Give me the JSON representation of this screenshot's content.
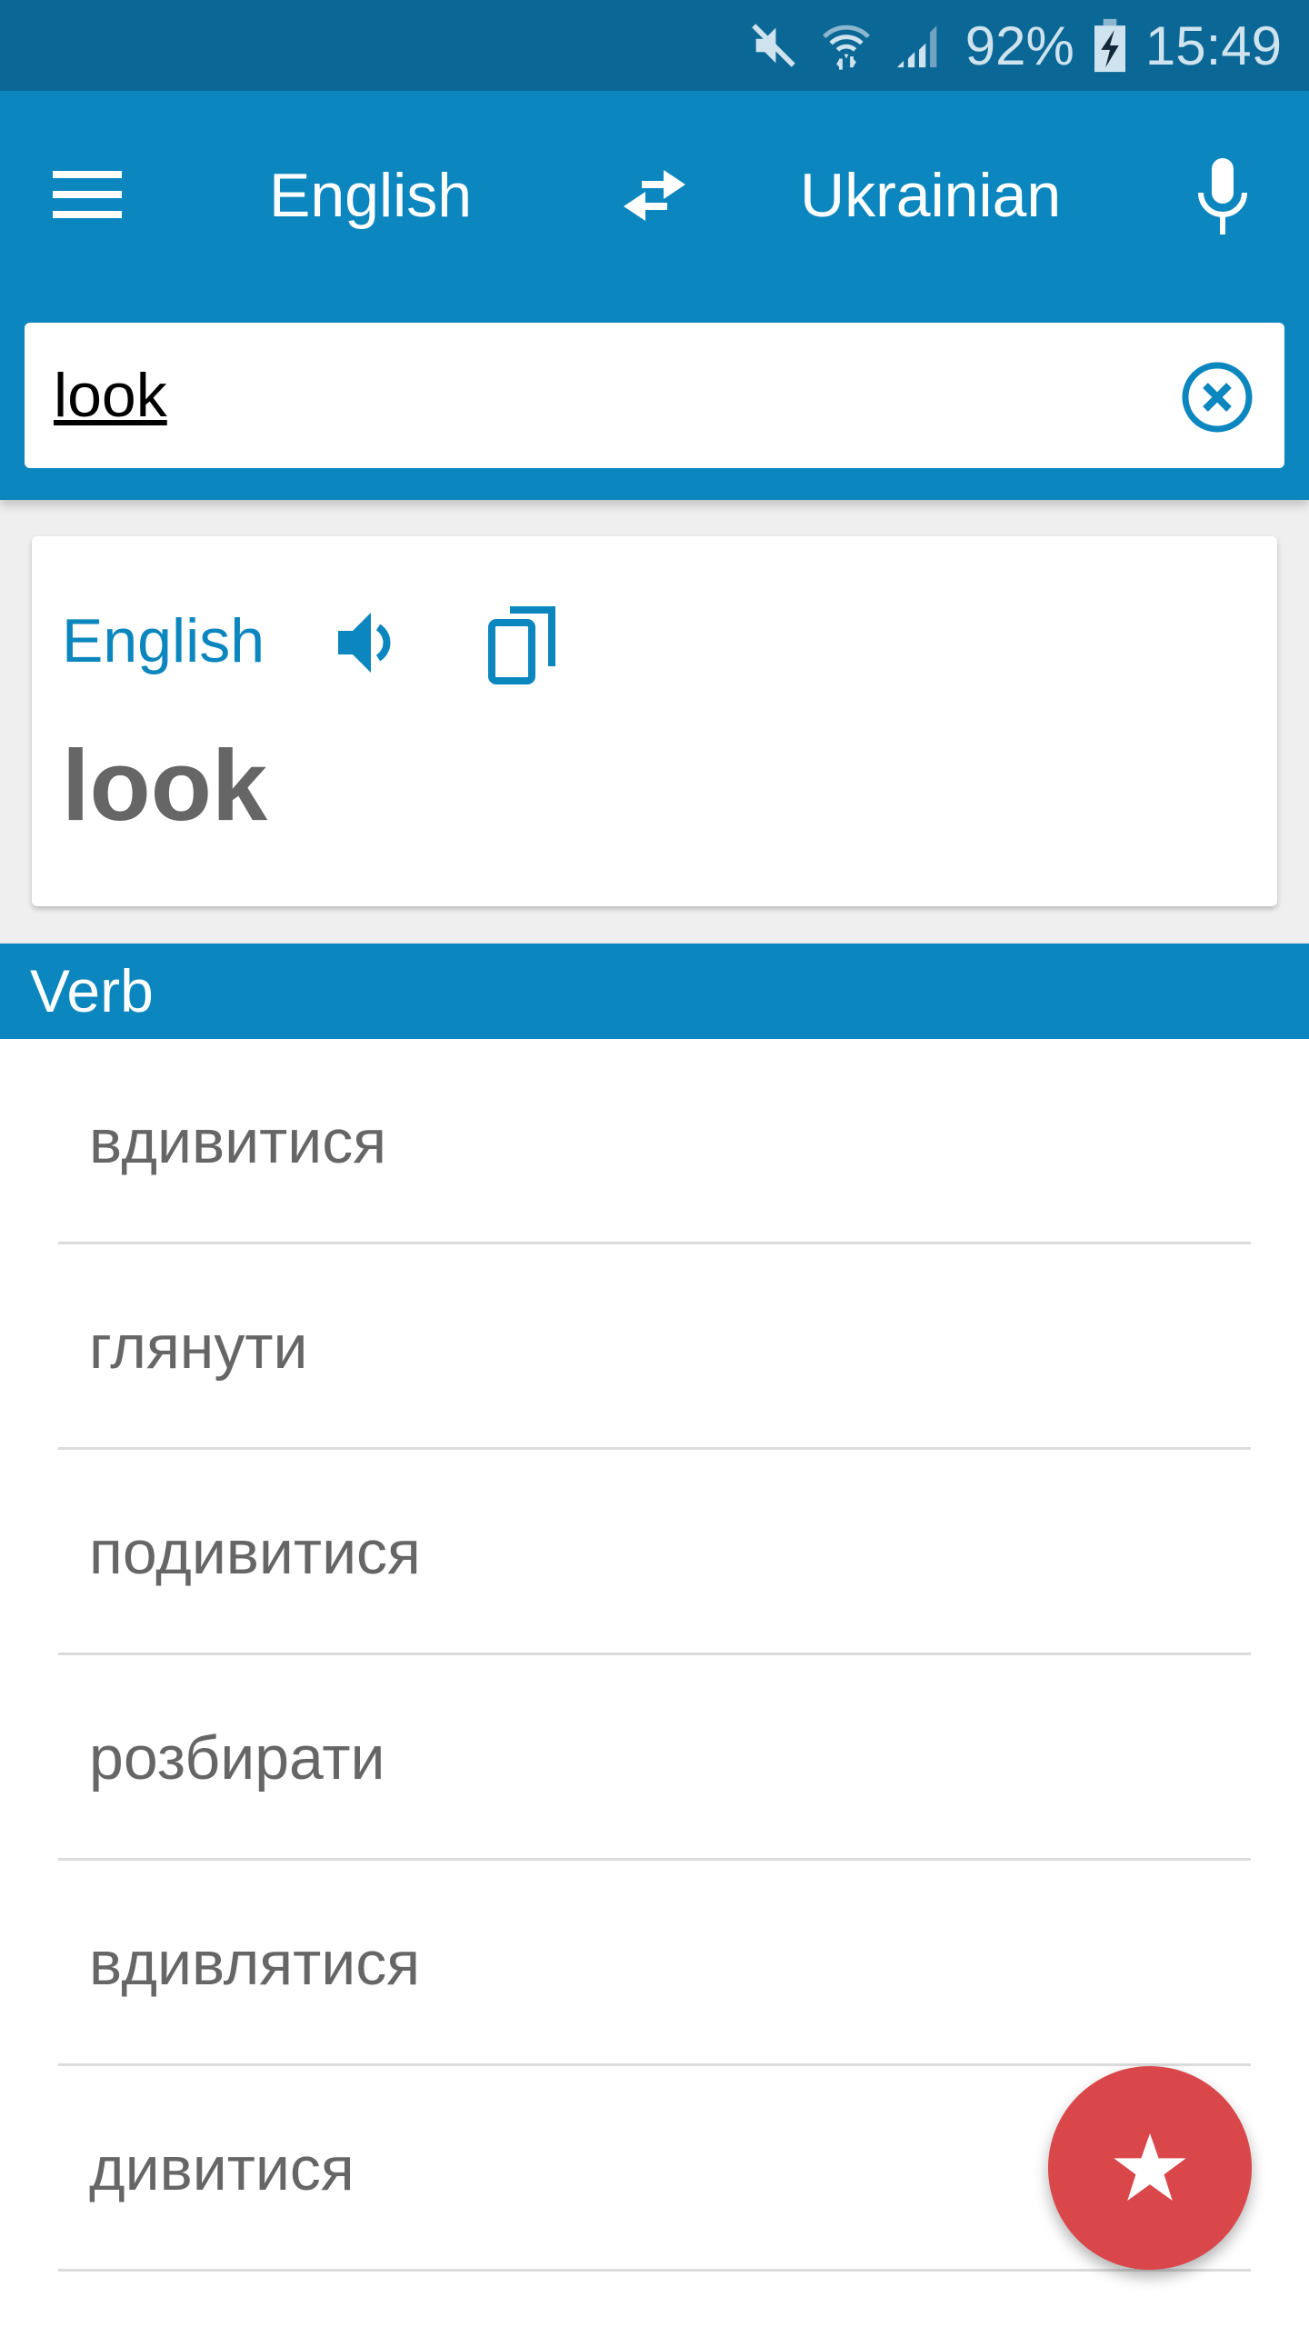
{
  "status_bar": {
    "battery_percent": "92%",
    "time": "15:49",
    "icons": [
      "mute-icon",
      "wifi-icon",
      "signal-icon",
      "battery-charging-icon"
    ]
  },
  "toolbar": {
    "menu_icon": "hamburger-menu-icon",
    "source_language": "English",
    "swap_icon": "swap-arrows-icon",
    "target_language": "Ukrainian",
    "mic_icon": "microphone-icon"
  },
  "search": {
    "value": "look",
    "clear_icon": "clear-circle-x-icon"
  },
  "result_card": {
    "language": "English",
    "speak_icon": "speaker-icon",
    "copy_icon": "copy-icon",
    "word": "look"
  },
  "part_of_speech": "Verb",
  "translations": [
    "вдивитися",
    "глянути",
    "подивитися",
    "розбирати",
    "вдивлятися",
    "дивитися"
  ],
  "fab": {
    "icon": "star-icon"
  },
  "colors": {
    "primary": "#0b86be",
    "status_bar": "#0b6896",
    "fab": "#d9474b",
    "text_gray": "#666666"
  }
}
